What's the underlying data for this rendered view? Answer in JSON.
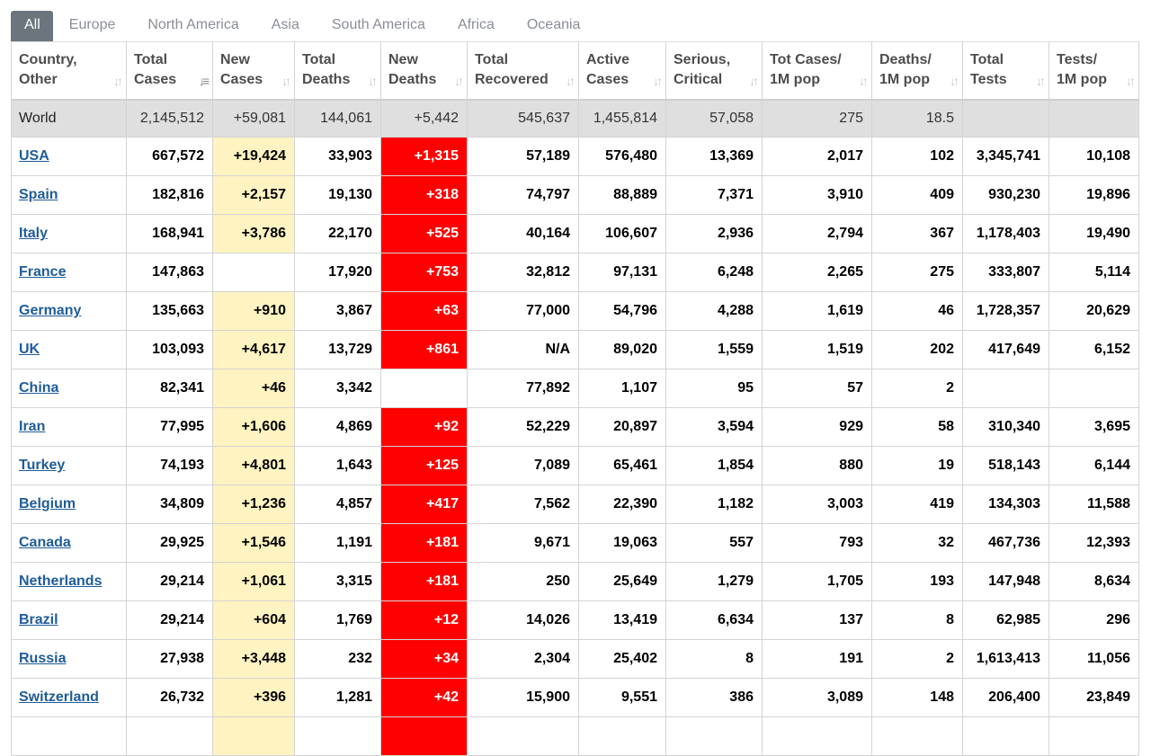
{
  "tabs": [
    "All",
    "Europe",
    "North America",
    "Asia",
    "South America",
    "Africa",
    "Oceania"
  ],
  "columns": [
    [
      "Country,",
      "Other"
    ],
    [
      "Total",
      "Cases"
    ],
    [
      "New",
      "Cases"
    ],
    [
      "Total",
      "Deaths"
    ],
    [
      "New",
      "Deaths"
    ],
    [
      "Total",
      "Recovered"
    ],
    [
      "Active",
      "Cases"
    ],
    [
      "Serious,",
      "Critical"
    ],
    [
      "Tot Cases/",
      "1M pop"
    ],
    [
      "Deaths/",
      "1M pop"
    ],
    [
      "Total",
      "Tests"
    ],
    [
      "Tests/",
      "1M pop"
    ]
  ],
  "icons": {
    "sort": "sort-icon",
    "sort_active": "sort-desc-icon"
  },
  "colors": {
    "new_cases_bg": "#fff3c1",
    "new_deaths_bg": "#ff0000",
    "world_row_bg": "#dfdfdf",
    "country_link": "#1f5c99",
    "active_tab_bg": "#6c757d"
  },
  "world": [
    "World",
    "2,145,512",
    "+59,081",
    "144,061",
    "+5,442",
    "545,637",
    "1,455,814",
    "57,058",
    "275",
    "18.5",
    "",
    ""
  ],
  "rows": [
    [
      "USA",
      "667,572",
      "+19,424",
      "33,903",
      "+1,315",
      "57,189",
      "576,480",
      "13,369",
      "2,017",
      "102",
      "3,345,741",
      "10,108"
    ],
    [
      "Spain",
      "182,816",
      "+2,157",
      "19,130",
      "+318",
      "74,797",
      "88,889",
      "7,371",
      "3,910",
      "409",
      "930,230",
      "19,896"
    ],
    [
      "Italy",
      "168,941",
      "+3,786",
      "22,170",
      "+525",
      "40,164",
      "106,607",
      "2,936",
      "2,794",
      "367",
      "1,178,403",
      "19,490"
    ],
    [
      "France",
      "147,863",
      "",
      "17,920",
      "+753",
      "32,812",
      "97,131",
      "6,248",
      "2,265",
      "275",
      "333,807",
      "5,114"
    ],
    [
      "Germany",
      "135,663",
      "+910",
      "3,867",
      "+63",
      "77,000",
      "54,796",
      "4,288",
      "1,619",
      "46",
      "1,728,357",
      "20,629"
    ],
    [
      "UK",
      "103,093",
      "+4,617",
      "13,729",
      "+861",
      "N/A",
      "89,020",
      "1,559",
      "1,519",
      "202",
      "417,649",
      "6,152"
    ],
    [
      "China",
      "82,341",
      "+46",
      "3,342",
      "",
      "77,892",
      "1,107",
      "95",
      "57",
      "2",
      "",
      ""
    ],
    [
      "Iran",
      "77,995",
      "+1,606",
      "4,869",
      "+92",
      "52,229",
      "20,897",
      "3,594",
      "929",
      "58",
      "310,340",
      "3,695"
    ],
    [
      "Turkey",
      "74,193",
      "+4,801",
      "1,643",
      "+125",
      "7,089",
      "65,461",
      "1,854",
      "880",
      "19",
      "518,143",
      "6,144"
    ],
    [
      "Belgium",
      "34,809",
      "+1,236",
      "4,857",
      "+417",
      "7,562",
      "22,390",
      "1,182",
      "3,003",
      "419",
      "134,303",
      "11,588"
    ],
    [
      "Canada",
      "29,925",
      "+1,546",
      "1,191",
      "+181",
      "9,671",
      "19,063",
      "557",
      "793",
      "32",
      "467,736",
      "12,393"
    ],
    [
      "Netherlands",
      "29,214",
      "+1,061",
      "3,315",
      "+181",
      "250",
      "25,649",
      "1,279",
      "1,705",
      "193",
      "147,948",
      "8,634"
    ],
    [
      "Brazil",
      "29,214",
      "+604",
      "1,769",
      "+12",
      "14,026",
      "13,419",
      "6,634",
      "137",
      "8",
      "62,985",
      "296"
    ],
    [
      "Russia",
      "27,938",
      "+3,448",
      "232",
      "+34",
      "2,304",
      "25,402",
      "8",
      "191",
      "2",
      "1,613,413",
      "11,056"
    ],
    [
      "Switzerland",
      "26,732",
      "+396",
      "1,281",
      "+42",
      "15,900",
      "9,551",
      "386",
      "3,089",
      "148",
      "206,400",
      "23,849"
    ],
    [
      "",
      "",
      "",
      "",
      "",
      "",
      "",
      "",
      "",
      "",
      "",
      ""
    ]
  ]
}
